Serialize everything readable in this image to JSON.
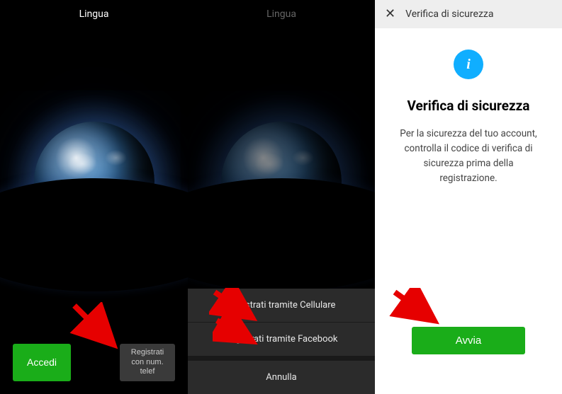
{
  "panel1": {
    "header": "Lingua",
    "login_label": "Accedi",
    "register_label": "Registrati con num. telef"
  },
  "panel2": {
    "header": "Lingua",
    "sheet": {
      "option_mobile": "Registrati tramite Cellulare",
      "option_facebook": "Registrati tramite Facebook",
      "cancel": "Annulla"
    }
  },
  "panel3": {
    "header": "Verifica di sicurezza",
    "info_icon_glyph": "i",
    "title": "Verifica di sicurezza",
    "description": "Per la sicurezza del tuo account, controlla il codice di verifica di sicurezza prima della registrazione.",
    "start_label": "Avvia"
  }
}
